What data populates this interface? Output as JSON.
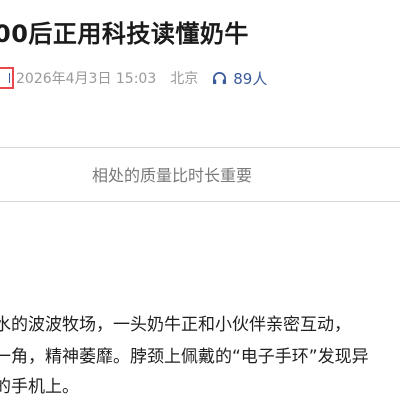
{
  "article": {
    "headline": "00后正用科技读懂奶牛",
    "meta": {
      "date": "2026年4月3日 15:03",
      "location": "北京",
      "readers": "89人"
    },
    "subtitle": "相处的质量比时长重要",
    "paragraph_lines": [
      "水的波波牧场，一头奶牛正和小伙伴亲密互动，",
      "一角，精神萎靡。脖颈上佩戴的“电子手环”发现异",
      "的手机上。"
    ]
  },
  "colors": {
    "highlight_border": "#e8474c",
    "accent_link": "#3a5a9a",
    "meta_text": "#9a9a9a"
  },
  "icons": {
    "readers": "headphones-icon"
  }
}
